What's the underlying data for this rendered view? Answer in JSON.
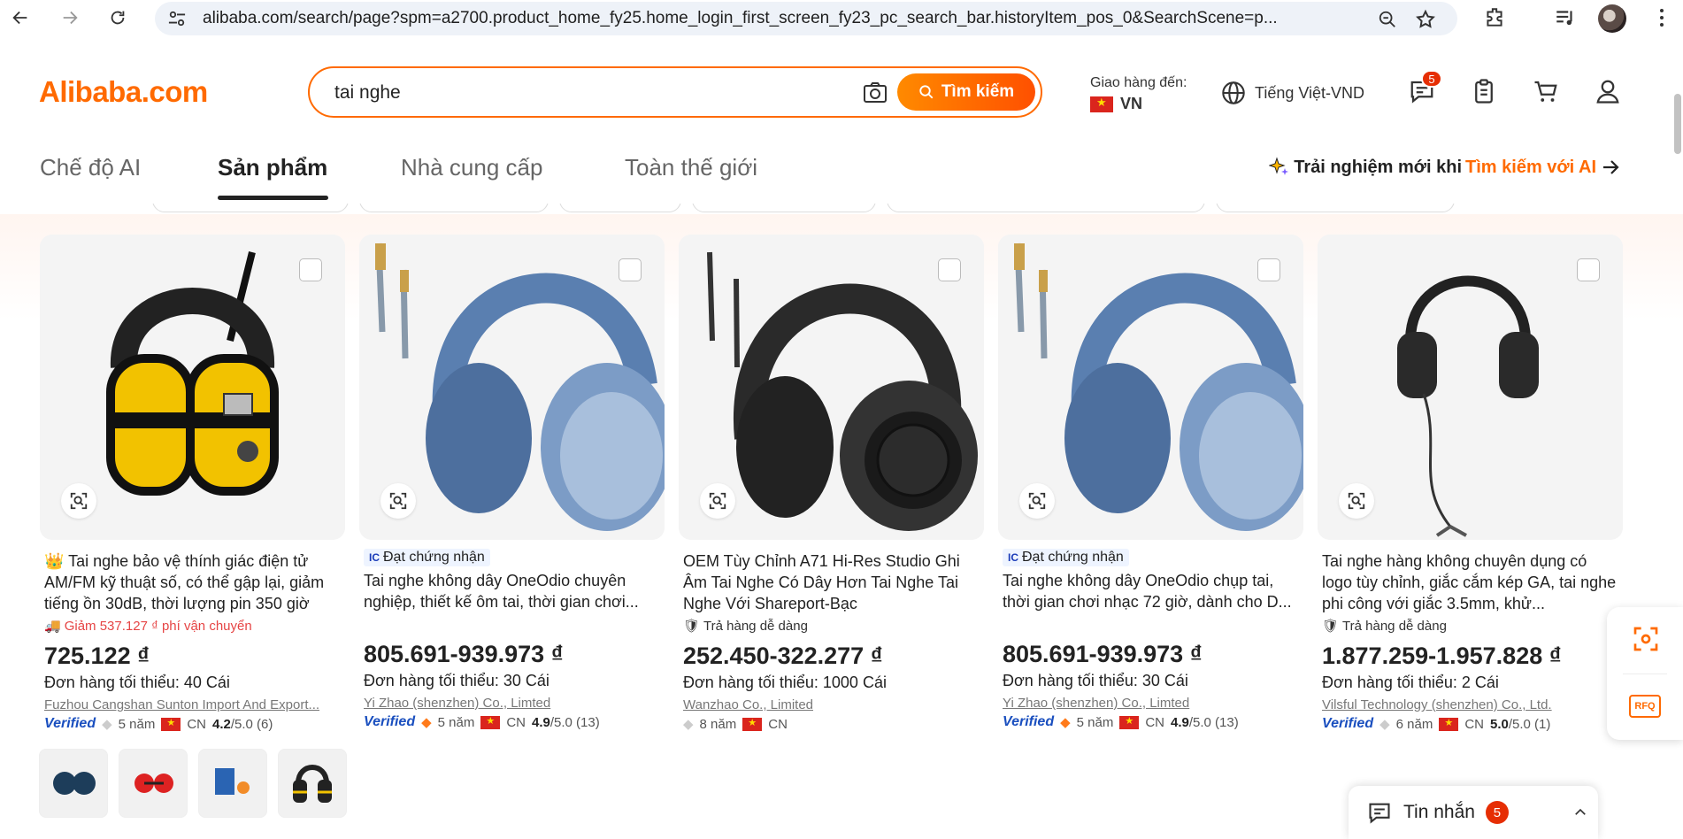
{
  "browser": {
    "url": "alibaba.com/search/page?spm=a2700.product_home_fy25.home_login_first_screen_fy23_pc_search_bar.historyItem_pos_0&SearchScene=p..."
  },
  "header": {
    "logo": "Alibaba.com",
    "search_value": "tai nghe",
    "search_button": "Tìm kiếm",
    "deliver_label": "Giao hàng đến:",
    "deliver_country": "VN",
    "language": "Tiếng Việt-VND",
    "messages_badge": "5",
    "accent_color": "#ff6a00"
  },
  "tabs": [
    {
      "label": "Chế độ AI"
    },
    {
      "label": "Sản phẩm"
    },
    {
      "label": "Nhà cung cấp"
    },
    {
      "label": "Toàn thế giới"
    }
  ],
  "ai_promo": {
    "prefix": "Trải nghiệm mới khi ",
    "highlight": "Tìm kiếm với AI"
  },
  "products": [
    {
      "title": "Tai nghe bảo vệ thính giác điện tử AM/FM kỹ thuật số, có thể gập lại, giảm tiếng ồn 30dB, thời lượng pin 350 giờ",
      "crown": "👑",
      "perk": "Giảm 537.127 ₫ phí vận chuyển",
      "price": "725.122 ₫",
      "moq": "Đơn hàng tối thiểu: 40 Cái",
      "supplier": "Fuzhou Cangshan Sunton Import And Export...",
      "verified": "Verified",
      "years": "5 năm",
      "country": "CN",
      "rating": "4.2",
      "rating_rest": "/5.0 (6)"
    },
    {
      "badge": "Đạt chứng nhận",
      "title": "Tai nghe không dây OneOdio chuyên nghiệp, thiết kế ôm tai, thời gian chơi...",
      "price": "805.691-939.973 ₫",
      "moq": "Đơn hàng tối thiểu: 30 Cái",
      "supplier": "Yi Zhao (shenzhen) Co., Limted",
      "verified": "Verified",
      "years": "5 năm",
      "country": "CN",
      "rating": "4.9",
      "rating_rest": "/5.0 (13)"
    },
    {
      "title": "OEM Tùy Chỉnh A71 Hi-Res Studio Ghi Âm Tai Nghe Có Dây Hơn Tai Nghe Tai Nghe Với Shareport-Bạc",
      "perk": "Trả hàng dễ dàng",
      "price": "252.450-322.277 ₫",
      "moq": "Đơn hàng tối thiểu: 1000 Cái",
      "supplier": "Wanzhao Co., Limited",
      "years": "8 năm",
      "country": "CN"
    },
    {
      "badge": "Đạt chứng nhận",
      "title": "Tai nghe không dây OneOdio chụp tai, thời gian chơi nhạc 72 giờ, dành cho D...",
      "price": "805.691-939.973 ₫",
      "moq": "Đơn hàng tối thiểu: 30 Cái",
      "supplier": "Yi Zhao (shenzhen) Co., Limted",
      "verified": "Verified",
      "years": "5 năm",
      "country": "CN",
      "rating": "4.9",
      "rating_rest": "/5.0 (13)"
    },
    {
      "title": "Tai nghe hàng không chuyên dụng có logo tùy chỉnh, giắc cắm kép GA, tai nghe phi công với giắc 3.5mm, khử...",
      "perk": "Trả hàng dễ dàng",
      "price": "1.877.259-1.957.828 ₫",
      "moq": "Đơn hàng tối thiểu: 2 Cái",
      "supplier": "Vilsful Technology (shenzhen) Co., Ltd.",
      "verified": "Verified",
      "years": "6 năm",
      "country": "CN",
      "rating": "5.0",
      "rating_rest": "/5.0 (1)"
    }
  ],
  "float": {
    "rfq": "RFQ"
  },
  "messenger": {
    "label": "Tin nhắn",
    "count": "5"
  }
}
